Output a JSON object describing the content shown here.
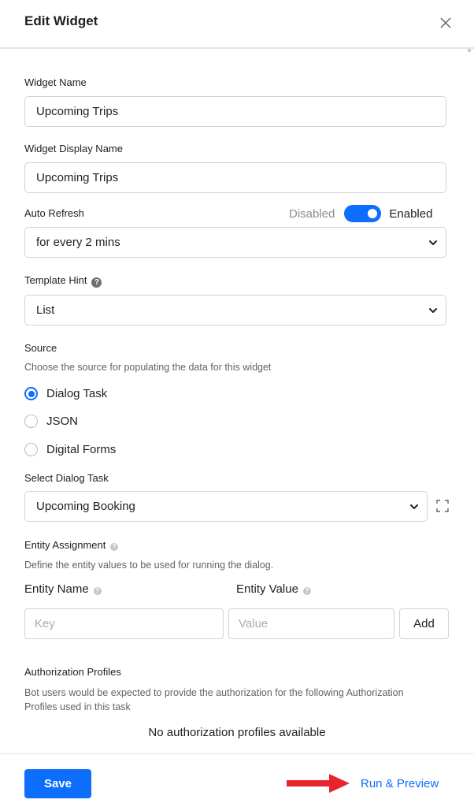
{
  "header": {
    "title": "Edit Widget",
    "close_icon": "close-icon"
  },
  "widget_name": {
    "label": "Widget Name",
    "value": "Upcoming Trips"
  },
  "display_name": {
    "label": "Widget Display Name",
    "value": "Upcoming Trips"
  },
  "auto_refresh": {
    "label": "Auto Refresh",
    "toggle_off_label": "Disabled",
    "toggle_on_label": "Enabled",
    "enabled": true,
    "value": "for every 2 mins"
  },
  "template_hint": {
    "label": "Template Hint",
    "value": "List",
    "help_icon": "question-circle-icon"
  },
  "source": {
    "label": "Source",
    "description": "Choose the source for populating the data for this widget",
    "options": [
      "Dialog Task",
      "JSON",
      "Digital Forms"
    ],
    "selected": "Dialog Task"
  },
  "dialog_task": {
    "label": "Select Dialog Task",
    "value": "Upcoming Booking",
    "expand_icon": "expand-icon"
  },
  "entity_assignment": {
    "label": "Entity Assignment",
    "description": "Define the entity values to be used for running the dialog.",
    "name_label": "Entity Name",
    "value_label": "Entity Value",
    "key_placeholder": "Key",
    "value_placeholder": "Value",
    "add_label": "Add"
  },
  "authorization": {
    "label": "Authorization Profiles",
    "description": "Bot users would be expected to provide the authorization for the following Authorization Profiles used in this task",
    "empty": "No authorization profiles available"
  },
  "footer": {
    "save_label": "Save",
    "run_label": "Run & Preview"
  },
  "colors": {
    "accent": "#0d6efd",
    "annotation_arrow": "#e8232c"
  }
}
